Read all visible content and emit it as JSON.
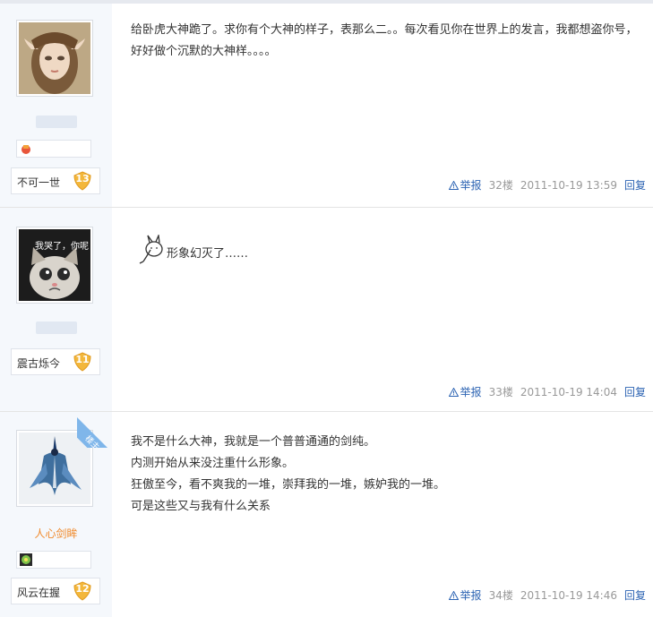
{
  "posts": [
    {
      "username": "",
      "level_title": "不可一世",
      "level": "13",
      "content_lines": [
        "给卧虎大神跪了。求你有个大神的样子，表那么二。。每次看见你在世界上的发言，我都想盗你号，好好做个沉默的大神样。。。。"
      ],
      "report": "举报",
      "floor": "32楼",
      "time": "2011-10-19 13:59",
      "reply": "回复",
      "avatar_icon": "doll-avatar-icon"
    },
    {
      "username": "",
      "level_title": "震古烁今",
      "level": "11",
      "avatar_caption": "我哭了，你呢",
      "content_text": "形象幻灭了……",
      "report": "举报",
      "floor": "33楼",
      "time": "2011-10-19 14:04",
      "reply": "回复",
      "avatar_icon": "crying-cat-avatar-icon"
    },
    {
      "username": "人心剑眸",
      "level_title": "风云在握",
      "level": "12",
      "corner_badge": "楼主",
      "content_lines": [
        "我不是什么大神，我就是一个普普通通的剑纯。",
        "内测开始从来没注重什么形象。",
        "狂傲至今，看不爽我的一堆，崇拜我的一堆，嫉妒我的一堆。",
        "可是这些又与我有什么关系"
      ],
      "report": "举报",
      "floor": "34楼",
      "time": "2011-10-19 14:46",
      "reply": "回复",
      "avatar_icon": "swordsman-avatar-icon"
    }
  ],
  "colors": {
    "sidebar_bg": "#f5f8fc",
    "link": "#2d64b3",
    "meta": "#999999",
    "username_orange": "#f08a2c",
    "level_badge": "#f3b73b",
    "corner_badge": "#7fb6ea"
  }
}
